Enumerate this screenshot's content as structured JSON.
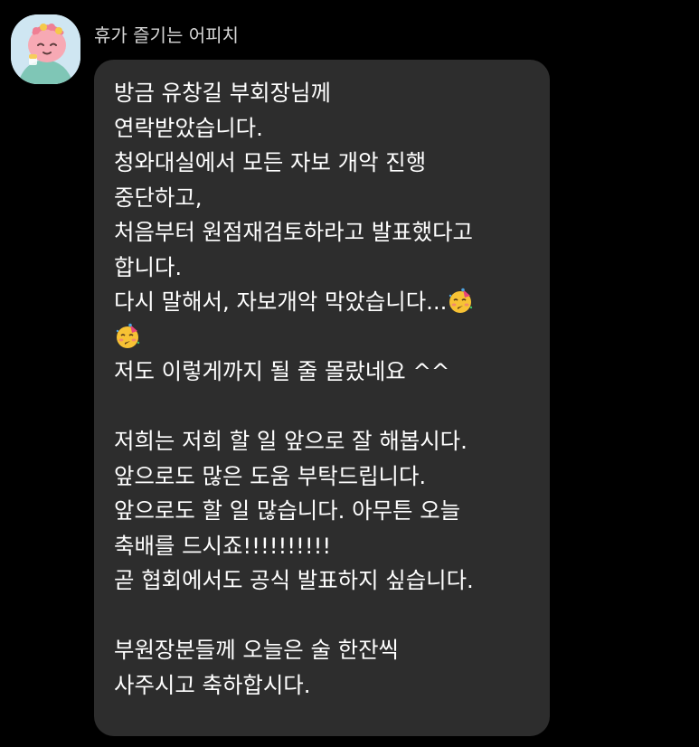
{
  "chat": {
    "sender_name": "휴가 즐기는 어피치",
    "avatar_icon": "apeach-party-avatar-icon",
    "emoji_icon": "partying-face-emoji",
    "message": {
      "lines": [
        "방금 유창길 부회장님께",
        "연락받았습니다.",
        "청와대실에서 모든 자보 개악 진행",
        "중단하고,",
        "처음부터 원점재검토하라고 발표했다고",
        "합니다.",
        "다시 말해서, 자보개악 막았습니다...",
        "",
        "저도 이렇게까지 될 줄 몰랐네요 ^^",
        "",
        "저희는 저희 할 일 앞으로 잘 해봅시다.",
        "앞으로도 많은 도움 부탁드립니다.",
        "앞으로도 할 일 많습니다. 아무튼 오늘",
        "축배를 드시죠!!!!!!!!!!",
        "곧 협회에서도 공식 발표하지 싶습니다.",
        "",
        "부원장분들께 오늘은 술 한잔씩",
        "사주시고 축하합시다."
      ]
    }
  },
  "colors": {
    "background": "#000000",
    "bubble": "#2d2d2d",
    "text": "#ffffff",
    "sender_text": "#d6d6d6"
  }
}
